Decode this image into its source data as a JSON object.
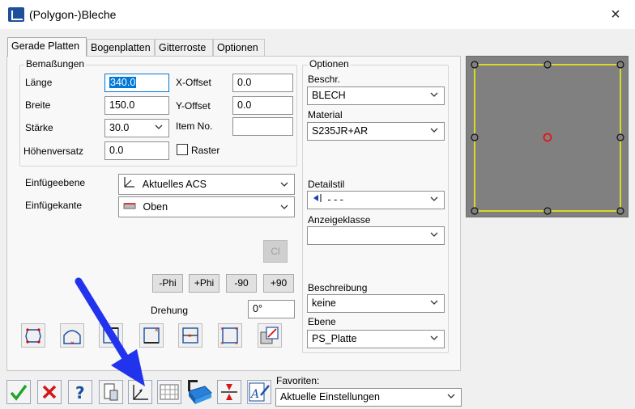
{
  "window": {
    "title": "(Polygon-)Bleche",
    "close_icon": "×"
  },
  "tabs": [
    "Gerade Platten",
    "Bogenplatten",
    "Gitterroste",
    "Optionen"
  ],
  "dimensions": {
    "group_label": "Bemaßungen",
    "laenge_label": "Länge",
    "laenge_value": "340.0",
    "breite_label": "Breite",
    "breite_value": "150.0",
    "staerke_label": "Stärke",
    "staerke_value": "30.0",
    "hoehenversatz_label": "Höhenversatz",
    "hoehenversatz_value": "0.0",
    "xoffset_label": "X-Offset",
    "xoffset_value": "0.0",
    "yoffset_label": "Y-Offset",
    "yoffset_value": "0.0",
    "itemno_label": "Item No.",
    "itemno_value": "",
    "raster_label": "Raster"
  },
  "insertion": {
    "ebene_label": "Einfügeebene",
    "ebene_value": "Aktuelles ACS",
    "kante_label": "Einfügekante",
    "kante_value": "Oben"
  },
  "rotation": {
    "cl_label": "Cl",
    "buttons": [
      "-Phi",
      "+Phi",
      "-90",
      "+90"
    ],
    "drehung_label": "Drehung",
    "drehung_value": "0°"
  },
  "options": {
    "group_label": "Optionen",
    "beschr_label": "Beschr.",
    "beschr_value": "BLECH",
    "material_label": "Material",
    "material_value": "S235JR+AR",
    "detailstil_label": "Detailstil",
    "detailstil_value": "- - -",
    "anzeigeklasse_label": "Anzeigeklasse",
    "anzeigeklasse_value": "",
    "beschreibung_label": "Beschreibung",
    "beschreibung_value": "keine",
    "ebene_label": "Ebene",
    "ebene_value": "PS_Platte"
  },
  "favorites": {
    "label": "Favoriten:",
    "value": "Aktuelle Einstellungen"
  },
  "colors": {
    "accent": "#0078d7",
    "preview_bg": "#808080",
    "plate_outline": "#ffff00",
    "center_marker": "#ff0000",
    "annotation_arrow": "#2233ee"
  }
}
